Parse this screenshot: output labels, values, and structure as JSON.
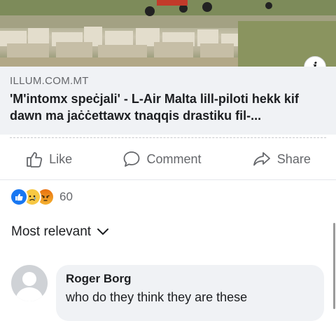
{
  "link_preview": {
    "info_icon": "info-icon",
    "domain": "ILLUM.COM.MT",
    "headline": "'M'intomx speċjali' - L-Air Malta lill-piloti hekk kif dawn ma jaċċettawx tnaqqis drastiku fil-..."
  },
  "actions": {
    "like_label": "Like",
    "comment_label": "Comment",
    "share_label": "Share",
    "like_icon": "thumbs-up-icon",
    "comment_icon": "comment-bubble-icon",
    "share_icon": "share-arrow-icon"
  },
  "reactions": {
    "icons": [
      "like-reaction-icon",
      "sad-reaction-icon",
      "angry-reaction-icon"
    ],
    "count": "60"
  },
  "comments": {
    "sort_label": "Most relevant",
    "items": [
      {
        "author": "Roger Borg",
        "text": "who do they think they are these"
      }
    ]
  },
  "colors": {
    "accent": "#1877f2",
    "secondary_text": "#65676b",
    "bubble_bg": "#f0f2f5"
  }
}
